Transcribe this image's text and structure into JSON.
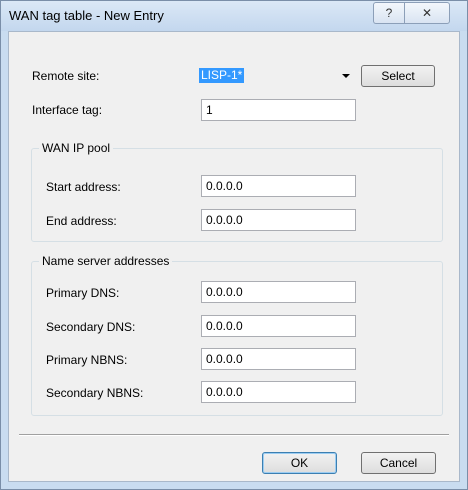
{
  "window": {
    "title": "WAN tag table - New Entry",
    "help_glyph": "?",
    "close_glyph": "✕"
  },
  "form": {
    "remote_site": {
      "label": "Remote site:",
      "value": "LISP-1*",
      "select_label": "Select"
    },
    "interface_tag": {
      "label": "Interface tag:",
      "value": "1"
    }
  },
  "wan_pool": {
    "title": "WAN IP pool",
    "start": {
      "label": "Start address:",
      "value": "0.0.0.0"
    },
    "end": {
      "label": "End address:",
      "value": "0.0.0.0"
    }
  },
  "name_servers": {
    "title": "Name server addresses",
    "primary_dns": {
      "label": "Primary DNS:",
      "value": "0.0.0.0"
    },
    "secondary_dns": {
      "label": "Secondary DNS:",
      "value": "0.0.0.0"
    },
    "primary_nbns": {
      "label": "Primary NBNS:",
      "value": "0.0.0.0"
    },
    "secondary_nbns": {
      "label": "Secondary NBNS:",
      "value": "0.0.0.0"
    }
  },
  "buttons": {
    "ok": "OK",
    "cancel": "Cancel"
  }
}
